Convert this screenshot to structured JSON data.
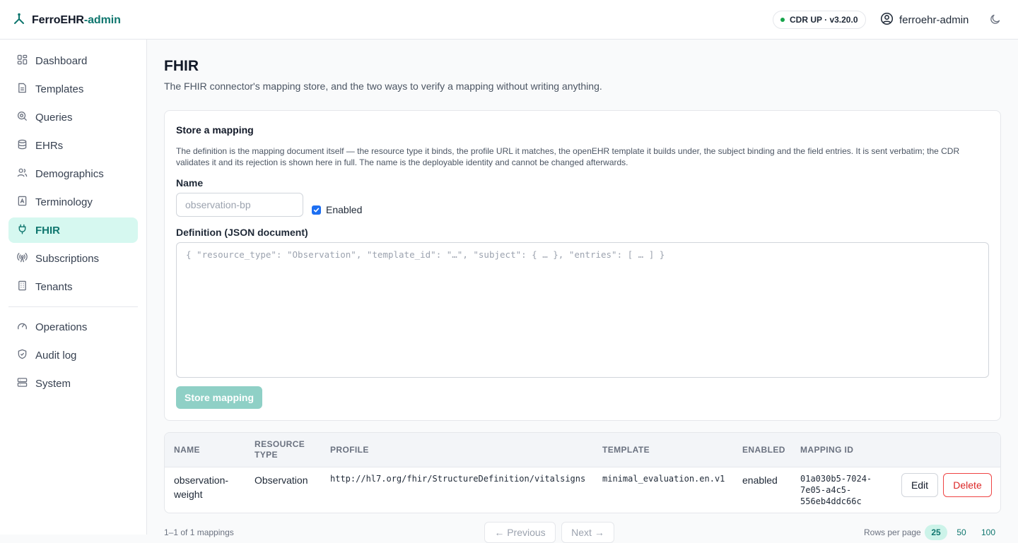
{
  "header": {
    "brand": "FerroEHR",
    "brand_suffix": "-admin",
    "status": "CDR UP · v3.20.0",
    "user": "ferroehr-admin"
  },
  "sidebar": {
    "items": [
      {
        "label": "Dashboard",
        "icon": "grid-icon"
      },
      {
        "label": "Templates",
        "icon": "file-icon"
      },
      {
        "label": "Queries",
        "icon": "search-icon"
      },
      {
        "label": "EHRs",
        "icon": "database-icon"
      },
      {
        "label": "Demographics",
        "icon": "users-icon"
      },
      {
        "label": "Terminology",
        "icon": "book-icon"
      },
      {
        "label": "FHIR",
        "icon": "plug-icon",
        "active": true
      },
      {
        "label": "Subscriptions",
        "icon": "broadcast-icon"
      },
      {
        "label": "Tenants",
        "icon": "building-icon"
      }
    ],
    "secondary": [
      {
        "label": "Operations",
        "icon": "gauge-icon"
      },
      {
        "label": "Audit log",
        "icon": "shield-icon"
      },
      {
        "label": "System",
        "icon": "server-icon"
      }
    ]
  },
  "page": {
    "title": "FHIR",
    "subtitle": "The FHIR connector's mapping store, and the two ways to verify a mapping without writing anything."
  },
  "store_card": {
    "title": "Store a mapping",
    "description": "The definition is the mapping document itself — the resource type it binds, the profile URL it matches, the openEHR template it builds under, the subject binding and the field entries. It is sent verbatim; the CDR validates it and its rejection is shown here in full. The name is the deployable identity and cannot be changed afterwards.",
    "name_label": "Name",
    "name_placeholder": "observation-bp",
    "name_value": "",
    "enabled_label": "Enabled",
    "enabled_checked": true,
    "definition_label": "Definition (JSON document)",
    "definition_placeholder": "{ \"resource_type\": \"Observation\", \"template_id\": \"…\", \"subject\": { … }, \"entries\": [ … ] }",
    "store_button": "Store mapping"
  },
  "table": {
    "columns": [
      "NAME",
      "RESOURCE TYPE",
      "PROFILE",
      "TEMPLATE",
      "ENABLED",
      "MAPPING ID"
    ],
    "column_lines": {
      "resource_type_1": "RESOURCE",
      "resource_type_2": "TYPE"
    },
    "rows": [
      {
        "name_1": "observation-",
        "name_2": "weight",
        "resource_type": "Observation",
        "profile": "http://hl7.org/fhir/StructureDefinition/vitalsigns",
        "template": "minimal_evaluation.en.v1",
        "enabled": "enabled",
        "mapping_id_1": "01a030b5-7024-",
        "mapping_id_2": "7e05-a4c5-",
        "mapping_id_3": "556eb4ddc66c",
        "edit_label": "Edit",
        "delete_label": "Delete"
      }
    ]
  },
  "footer": {
    "count": "1–1 of 1 mappings",
    "previous": "← Previous",
    "next": "Next →",
    "rows_per_page_label": "Rows per page",
    "rows_options": [
      "25",
      "50",
      "100"
    ],
    "rows_selected": "25"
  },
  "colors": {
    "accent": "#0f766e",
    "active_bg": "#d6f8f0",
    "danger": "#dc2626",
    "status_ok": "#16a34a"
  }
}
